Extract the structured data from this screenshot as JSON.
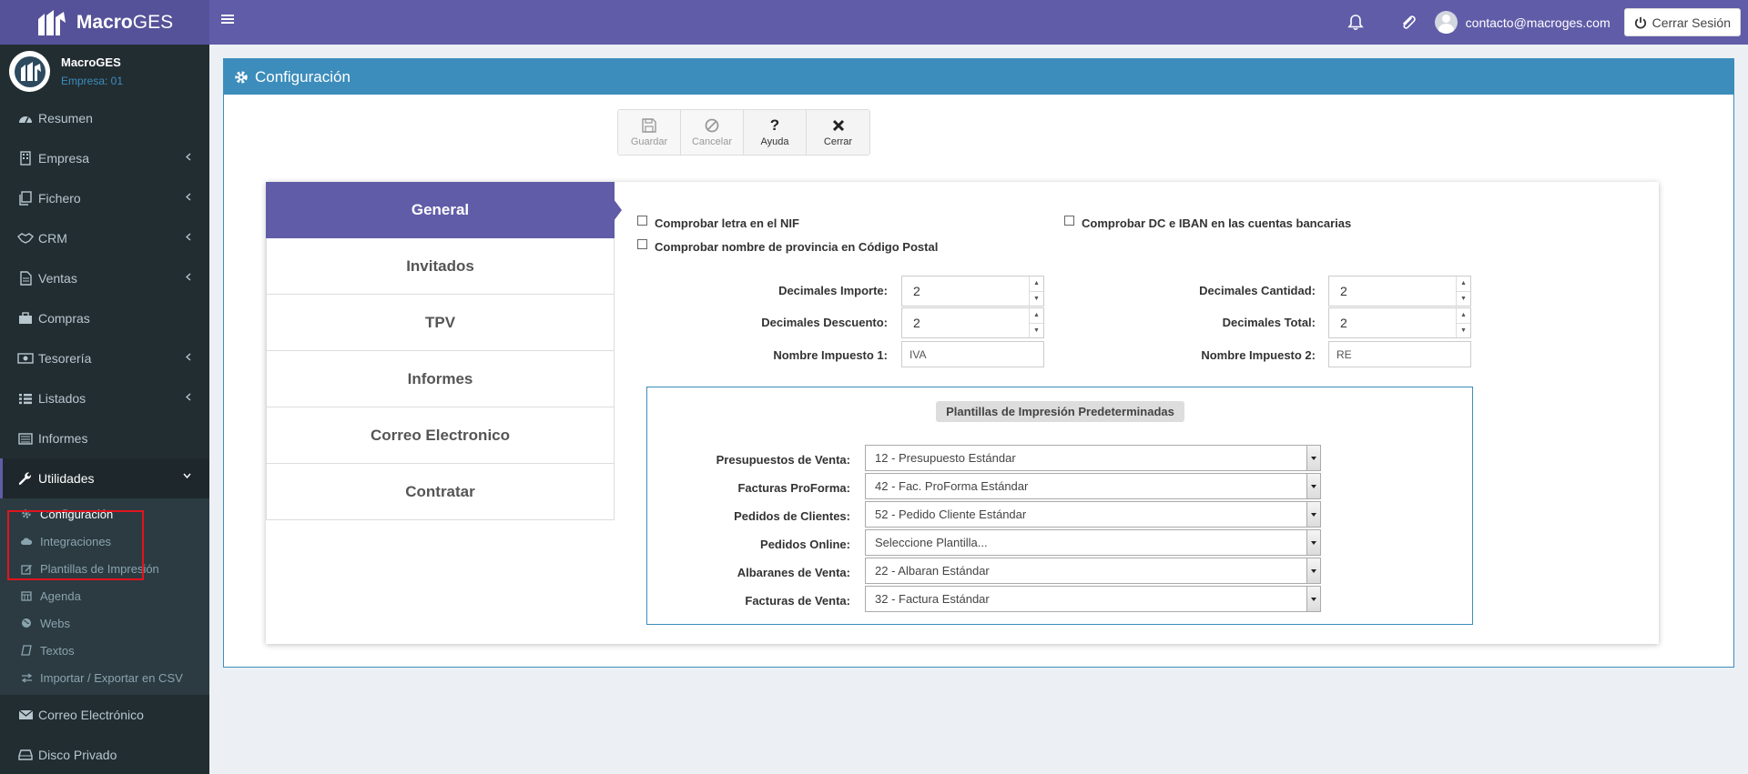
{
  "app": {
    "brand_prefix": "Macro",
    "brand_suffix": "GES",
    "user_email": "contacto@macroges.com",
    "logout_label": "Cerrar Sesión"
  },
  "user_panel": {
    "name": "MacroGES",
    "company": "Empresa: 01"
  },
  "sidebar": {
    "items": [
      {
        "label": "Resumen",
        "icon": "dashboard-icon",
        "has_chevron": false
      },
      {
        "label": "Empresa",
        "icon": "building-icon",
        "has_chevron": true
      },
      {
        "label": "Fichero",
        "icon": "files-icon",
        "has_chevron": true
      },
      {
        "label": "CRM",
        "icon": "handshake-icon",
        "has_chevron": true
      },
      {
        "label": "Ventas",
        "icon": "document-icon",
        "has_chevron": true
      },
      {
        "label": "Compras",
        "icon": "briefcase-icon",
        "has_chevron": false
      },
      {
        "label": "Tesorería",
        "icon": "money-icon",
        "has_chevron": true
      },
      {
        "label": "Listados",
        "icon": "list-icon",
        "has_chevron": true
      },
      {
        "label": "Informes",
        "icon": "report-icon",
        "has_chevron": false
      },
      {
        "label": "Utilidades",
        "icon": "wrench-icon",
        "has_chevron": true
      }
    ],
    "submenu": [
      {
        "label": "Configuración",
        "icon": "gear-icon"
      },
      {
        "label": "Integraciones",
        "icon": "cloud-icon"
      },
      {
        "label": "Plantillas de Impresión",
        "icon": "edit-icon"
      },
      {
        "label": "Agenda",
        "icon": "calendar-icon"
      },
      {
        "label": "Webs",
        "icon": "globe-icon"
      },
      {
        "label": "Textos",
        "icon": "book-icon"
      },
      {
        "label": "Importar / Exportar en CSV",
        "icon": "exchange-icon"
      }
    ],
    "bottom_items": [
      {
        "label": "Correo Electrónico",
        "icon": "envelope-icon"
      },
      {
        "label": "Disco Privado",
        "icon": "hdd-icon"
      }
    ]
  },
  "page": {
    "title": "Configuración"
  },
  "toolbar": {
    "save": "Guardar",
    "cancel": "Cancelar",
    "help": "Ayuda",
    "close": "Cerrar"
  },
  "tabs": [
    "General",
    "Invitados",
    "TPV",
    "Informes",
    "Correo Electronico",
    "Contratar"
  ],
  "general": {
    "checks": {
      "nif": "Comprobar letra en el NIF",
      "cp": "Comprobar nombre de provincia en Código Postal",
      "iban": "Comprobar DC e IBAN en las cuentas bancarias"
    },
    "fields": {
      "dec_importe_label": "Decimales Importe:",
      "dec_importe": "2",
      "dec_descuento_label": "Decimales Descuento:",
      "dec_descuento": "2",
      "impuesto1_label": "Nombre Impuesto 1:",
      "impuesto1": "IVA",
      "dec_cantidad_label": "Decimales Cantidad:",
      "dec_cantidad": "2",
      "dec_total_label": "Decimales Total:",
      "dec_total": "2",
      "impuesto2_label": "Nombre Impuesto 2:",
      "impuesto2": "RE"
    },
    "templates": {
      "title": "Plantillas de Impresión Predeterminadas",
      "rows": [
        {
          "label": "Presupuestos de Venta:",
          "value": "12 - Presupuesto Estándar"
        },
        {
          "label": "Facturas ProForma:",
          "value": "42 - Fac. ProForma Estándar"
        },
        {
          "label": "Pedidos de Clientes:",
          "value": "52 - Pedido Cliente Estándar"
        },
        {
          "label": "Pedidos Online:",
          "value": "Seleccione Plantilla..."
        },
        {
          "label": "Albaranes de Venta:",
          "value": "22 - Albaran Estándar"
        },
        {
          "label": "Facturas de Venta:",
          "value": "32 - Factura Estándar"
        }
      ]
    }
  },
  "colors": {
    "topbar": "#605ca8",
    "sidebar": "#222d32",
    "header": "#3c8dbc",
    "active_tab": "#605ca8",
    "highlight": "#e0141e"
  }
}
